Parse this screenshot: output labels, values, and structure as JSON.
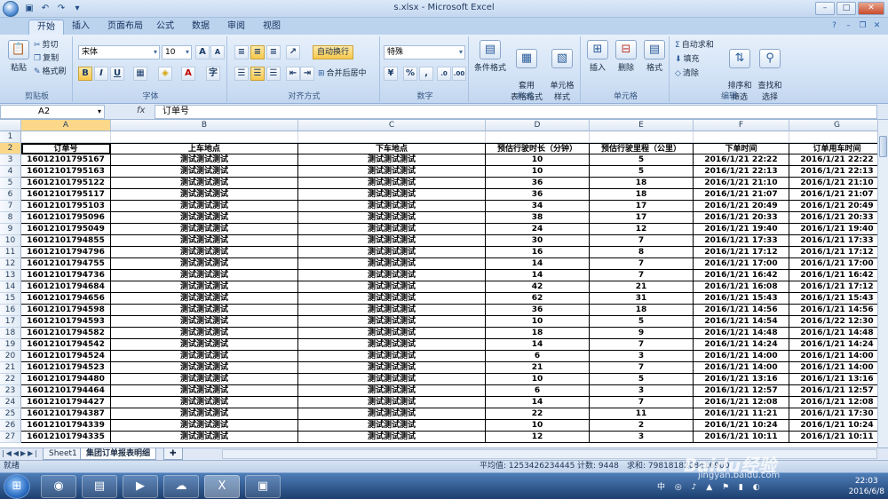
{
  "titlebar": {
    "title": "s.xlsx - Microsoft Excel"
  },
  "tabs": [
    "开始",
    "插入",
    "页面布局",
    "公式",
    "数据",
    "审阅",
    "视图"
  ],
  "ribbon": {
    "clipboard": {
      "paste": "粘贴",
      "cut": "剪切",
      "copy": "复制",
      "format_painter": "格式刷",
      "label": "剪贴板"
    },
    "font": {
      "name": "宋体",
      "size": "10",
      "label": "字体",
      "bold": "B",
      "italic": "I",
      "underline": "U"
    },
    "alignment": {
      "wrap": "自动换行",
      "merge": "合并后居中",
      "label": "对齐方式"
    },
    "number": {
      "format": "特殊",
      "label": "数字"
    },
    "styles": {
      "conditional": "条件格式",
      "table": "套用\n表格格式",
      "cell": "单元格\n样式",
      "label": "样式"
    },
    "cells": {
      "insert": "插入",
      "delete": "删除",
      "format": "格式",
      "label": "单元格"
    },
    "editing": {
      "autosum": "自动求和",
      "fill": "填充",
      "clear": "清除",
      "sort": "排序和\n筛选",
      "find": "查找和\n选择",
      "label": "编辑"
    }
  },
  "formula_bar": {
    "name_box": "A2",
    "fx": "fx",
    "content": "订单号"
  },
  "columns": [
    "A",
    "B",
    "C",
    "D",
    "E",
    "F",
    "G"
  ],
  "headers": [
    "订单号",
    "上车地点",
    "下车地点",
    "预估行驶时长（分钟）",
    "预估行驶里程（公里）",
    "下单时间",
    "订单用车时间"
  ],
  "rows": [
    [
      "16012101795167",
      "测试测试测试",
      "测试测试测试",
      "10",
      "5",
      "2016/1/21  22:22",
      "2016/1/21  22:22"
    ],
    [
      "16012101795163",
      "测试测试测试",
      "测试测试测试",
      "10",
      "5",
      "2016/1/21  22:13",
      "2016/1/21  22:13"
    ],
    [
      "16012101795122",
      "测试测试测试",
      "测试测试测试",
      "36",
      "18",
      "2016/1/21  21:10",
      "2016/1/21  21:10"
    ],
    [
      "16012101795117",
      "测试测试测试",
      "测试测试测试",
      "36",
      "18",
      "2016/1/21  21:07",
      "2016/1/21  21:07"
    ],
    [
      "16012101795103",
      "测试测试测试",
      "测试测试测试",
      "34",
      "17",
      "2016/1/21  20:49",
      "2016/1/21  20:49"
    ],
    [
      "16012101795096",
      "测试测试测试",
      "测试测试测试",
      "38",
      "17",
      "2016/1/21  20:33",
      "2016/1/21  20:33"
    ],
    [
      "16012101795049",
      "测试测试测试",
      "测试测试测试",
      "24",
      "12",
      "2016/1/21  19:40",
      "2016/1/21  19:40"
    ],
    [
      "16012101794855",
      "测试测试测试",
      "测试测试测试",
      "30",
      "7",
      "2016/1/21  17:33",
      "2016/1/21  17:33"
    ],
    [
      "16012101794796",
      "测试测试测试",
      "测试测试测试",
      "16",
      "8",
      "2016/1/21  17:12",
      "2016/1/21  17:12"
    ],
    [
      "16012101794755",
      "测试测试测试",
      "测试测试测试",
      "14",
      "7",
      "2016/1/21  17:00",
      "2016/1/21  17:00"
    ],
    [
      "16012101794736",
      "测试测试测试",
      "测试测试测试",
      "14",
      "7",
      "2016/1/21  16:42",
      "2016/1/21  16:42"
    ],
    [
      "16012101794684",
      "测试测试测试",
      "测试测试测试",
      "42",
      "21",
      "2016/1/21  16:08",
      "2016/1/21  17:12"
    ],
    [
      "16012101794656",
      "测试测试测试",
      "测试测试测试",
      "62",
      "31",
      "2016/1/21  15:43",
      "2016/1/21  15:43"
    ],
    [
      "16012101794598",
      "测试测试测试",
      "测试测试测试",
      "36",
      "18",
      "2016/1/21  14:56",
      "2016/1/21  14:56"
    ],
    [
      "16012101794593",
      "测试测试测试",
      "测试测试测试",
      "10",
      "5",
      "2016/1/21  14:54",
      "2016/1/22  12:30"
    ],
    [
      "16012101794582",
      "测试测试测试",
      "测试测试测试",
      "18",
      "9",
      "2016/1/21  14:48",
      "2016/1/21  14:48"
    ],
    [
      "16012101794542",
      "测试测试测试",
      "测试测试测试",
      "14",
      "7",
      "2016/1/21  14:24",
      "2016/1/21  14:24"
    ],
    [
      "16012101794524",
      "测试测试测试",
      "测试测试测试",
      "6",
      "3",
      "2016/1/21  14:00",
      "2016/1/21  14:00"
    ],
    [
      "16012101794523",
      "测试测试测试",
      "测试测试测试",
      "21",
      "7",
      "2016/1/21  14:00",
      "2016/1/21  14:00"
    ],
    [
      "16012101794480",
      "测试测试测试",
      "测试测试测试",
      "10",
      "5",
      "2016/1/21  13:16",
      "2016/1/21  13:16"
    ],
    [
      "16012101794464",
      "测试测试测试",
      "测试测试测试",
      "6",
      "3",
      "2016/1/21  12:57",
      "2016/1/21  12:57"
    ],
    [
      "16012101794427",
      "测试测试测试",
      "测试测试测试",
      "14",
      "7",
      "2016/1/21  12:08",
      "2016/1/21  12:08"
    ],
    [
      "16012101794387",
      "测试测试测试",
      "测试测试测试",
      "22",
      "11",
      "2016/1/21  11:21",
      "2016/1/21  17:30"
    ],
    [
      "16012101794339",
      "测试测试测试",
      "测试测试测试",
      "10",
      "2",
      "2016/1/21  10:24",
      "2016/1/21  10:24"
    ],
    [
      "16012101794335",
      "测试测试测试",
      "测试测试测试",
      "12",
      "3",
      "2016/1/21  10:11",
      "2016/1/21  10:11"
    ]
  ],
  "sheets": [
    "Sheet1",
    "集团订单报表明细"
  ],
  "active_sheet": 1,
  "status": {
    "ready": "就绪",
    "average": "平均值: 1253426234445",
    "count": "计数: 9448",
    "sum": "求和: 7981818268416900"
  },
  "taskbar": {
    "time": "22:03",
    "date": "2016/6/8",
    "ime": "中"
  },
  "watermark": {
    "text": "Baidu经验",
    "url": "jingyan.baidu.com"
  }
}
